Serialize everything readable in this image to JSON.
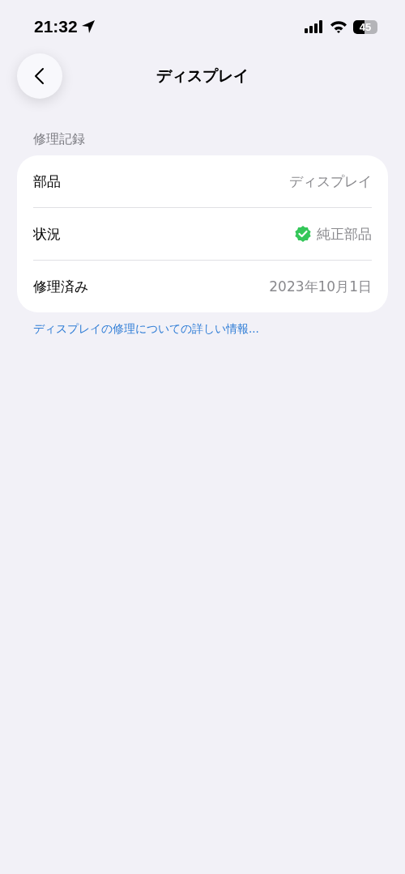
{
  "status_bar": {
    "time": "21:32",
    "battery": "45"
  },
  "nav": {
    "title": "ディスプレイ"
  },
  "section": {
    "header": "修理記録",
    "rows": [
      {
        "label": "部品",
        "value": "ディスプレイ",
        "kind": "text"
      },
      {
        "label": "状況",
        "value": "純正部品",
        "kind": "verified"
      },
      {
        "label": "修理済み",
        "value": "2023年10月1日",
        "kind": "text"
      }
    ],
    "link": "ディスプレイの修理についての詳しい情報..."
  }
}
